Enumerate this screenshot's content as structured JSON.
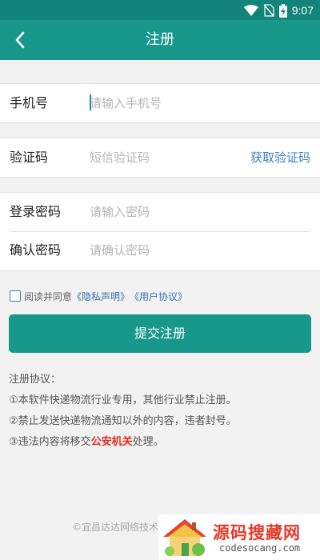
{
  "status_bar": {
    "time": "9:07",
    "icons": [
      "wifi-icon",
      "no-sim-icon",
      "battery-charging-icon"
    ]
  },
  "header": {
    "title": "注册",
    "back_icon": "chevron-left-icon"
  },
  "form": {
    "phone": {
      "label": "手机号",
      "placeholder": "请输入手机号",
      "value": ""
    },
    "code": {
      "label": "验证码",
      "placeholder": "短信验证码",
      "value": "",
      "action": "获取验证码"
    },
    "password": {
      "label": "登录密码",
      "placeholder": "请输入密码",
      "value": ""
    },
    "confirm": {
      "label": "确认密码",
      "placeholder": "请确认密码",
      "value": ""
    }
  },
  "agreement": {
    "checked": false,
    "prefix": "阅读并同意",
    "privacy_link": "《隐私声明》",
    "user_link": "《用户协议》"
  },
  "submit_label": "提交注册",
  "terms": {
    "title": "注册协议：",
    "item1": "①本软件快递物流行业专用，其他行业禁止注册。",
    "item2": "②禁止发送快递物流通知以外的内容，违者封号。",
    "item3_prefix": "③违法内容将移交",
    "item3_highlight": "公安机关",
    "item3_suffix": "处理。"
  },
  "footer": {
    "text": "©宜昌达达网络技术"
  },
  "watermark": {
    "text": "源码搜藏网",
    "domain": "codesocang.com"
  },
  "colors": {
    "primary": "#17988b",
    "status_bar": "#13847a",
    "link": "#3a7fc7",
    "highlight": "#e8281f",
    "background": "#f2f2f2"
  }
}
